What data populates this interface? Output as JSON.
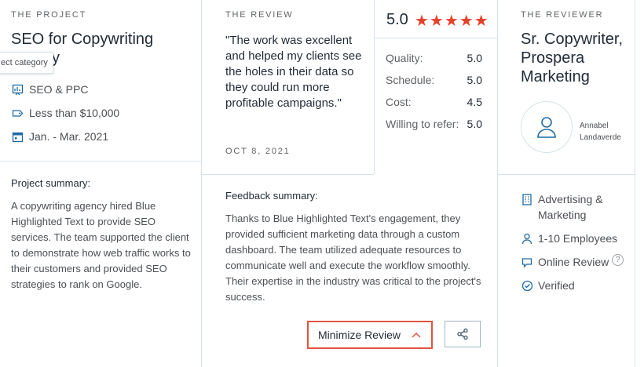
{
  "project": {
    "section_label": "THE PROJECT",
    "title_line1": "SEO for Copywriting",
    "title_line2": "y",
    "tooltip": "ect category",
    "service": "SEO & PPC",
    "budget": "Less than $10,000",
    "dates": "Jan. - Mar. 2021",
    "summary_title": "Project summary:",
    "summary": "A copywriting agency hired Blue Highlighted Text to provide SEO services. The team supported the client to demonstrate how web traffic works to their customers and provided SEO strategies to rank on Google."
  },
  "review": {
    "section_label": "THE REVIEW",
    "quote": "\"The work was excellent and helped my clients see the holes in their data so they could run more profitable campaigns.\"",
    "date": "OCT 8, 2021",
    "overall_score": "5.0",
    "stars": "★★★★★",
    "star_rating": 5,
    "ratings": [
      {
        "label": "Quality:",
        "value": "5.0"
      },
      {
        "label": "Schedule:",
        "value": "5.0"
      },
      {
        "label": "Cost:",
        "value": "4.5"
      },
      {
        "label": "Willing to refer:",
        "value": "5.0"
      }
    ],
    "feedback_title": "Feedback summary:",
    "feedback": "Thanks to Blue Highlighted Text's engagement, they provided sufficient marketing data through a custom dashboard. The team utilized adequate resources to communicate well and execute the workflow smoothly. Their expertise in the industry was critical to the project's success.",
    "minimize_label": "Minimize Review",
    "accent_color": "#e6402a"
  },
  "reviewer": {
    "section_label": "THE REVIEWER",
    "title": "Sr. Copywriter, Prospera Marketing",
    "name_line1": "Annabel",
    "name_line2": "Landaverde",
    "industry_line1": "Advertising &",
    "industry_line2": "Marketing",
    "size": "1-10 Employees",
    "review_type": "Online Review",
    "help_mark": "?",
    "status": "Verified"
  }
}
